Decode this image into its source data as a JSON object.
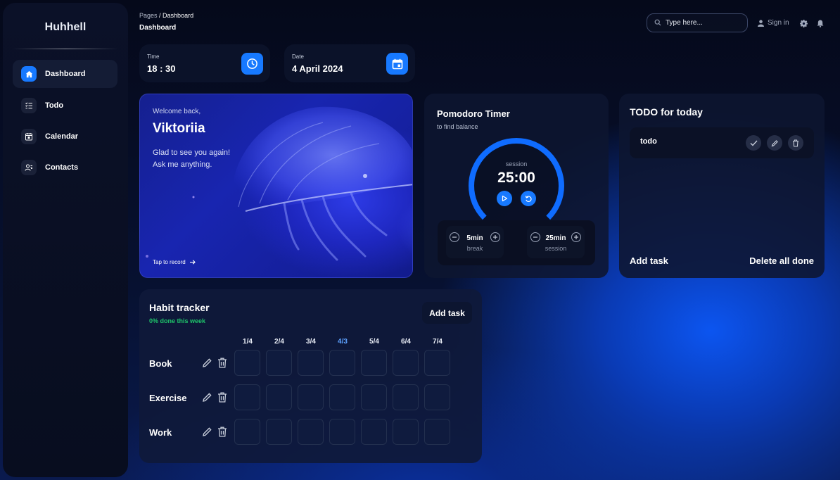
{
  "sidebar": {
    "brand": "Huhhell",
    "items": [
      {
        "label": "Dashboard",
        "icon": "home-icon",
        "active": true
      },
      {
        "label": "Todo",
        "icon": "checklist-icon"
      },
      {
        "label": "Calendar",
        "icon": "calendar-icon"
      },
      {
        "label": "Contacts",
        "icon": "contacts-icon"
      }
    ]
  },
  "header": {
    "breadcrumb_root": "Pages",
    "breadcrumb_separator": " / ",
    "breadcrumb_current": "Dashboard",
    "title": "Dashboard",
    "search_placeholder": "Type here...",
    "signin_label": "Sign in"
  },
  "stats": {
    "time_label": "Time",
    "time_value": "18 : 30",
    "date_label": "Date",
    "date_value": "4 April 2024"
  },
  "welcome": {
    "greeting": "Welcome back,",
    "name": "Viktoriia",
    "message_line1": "Glad to see you again!",
    "message_line2": "Ask me anything.",
    "record_label": "Tap to record"
  },
  "pomodoro": {
    "title": "Pomodoro Timer",
    "subtitle": "to find balance",
    "mode_label": "session",
    "time": "25:00",
    "progress": 0.75,
    "break_value": "5min",
    "break_label": "break",
    "session_value": "25min",
    "session_label": "session"
  },
  "todo": {
    "title": "TODO for today",
    "items": [
      {
        "text": "todo"
      }
    ],
    "add_label": "Add task",
    "delete_done_label": "Delete all done"
  },
  "habit": {
    "title": "Habit tracker",
    "progress_text": "0% done this week",
    "add_label": "Add task",
    "days": [
      "1/4",
      "2/4",
      "3/4",
      "4/3",
      "5/4",
      "6/4",
      "7/4"
    ],
    "today_index": 3,
    "rows": [
      {
        "name": "Book"
      },
      {
        "name": "Exercise"
      },
      {
        "name": "Work"
      }
    ]
  },
  "colors": {
    "accent": "#1779ff",
    "success": "#1fc46a"
  }
}
